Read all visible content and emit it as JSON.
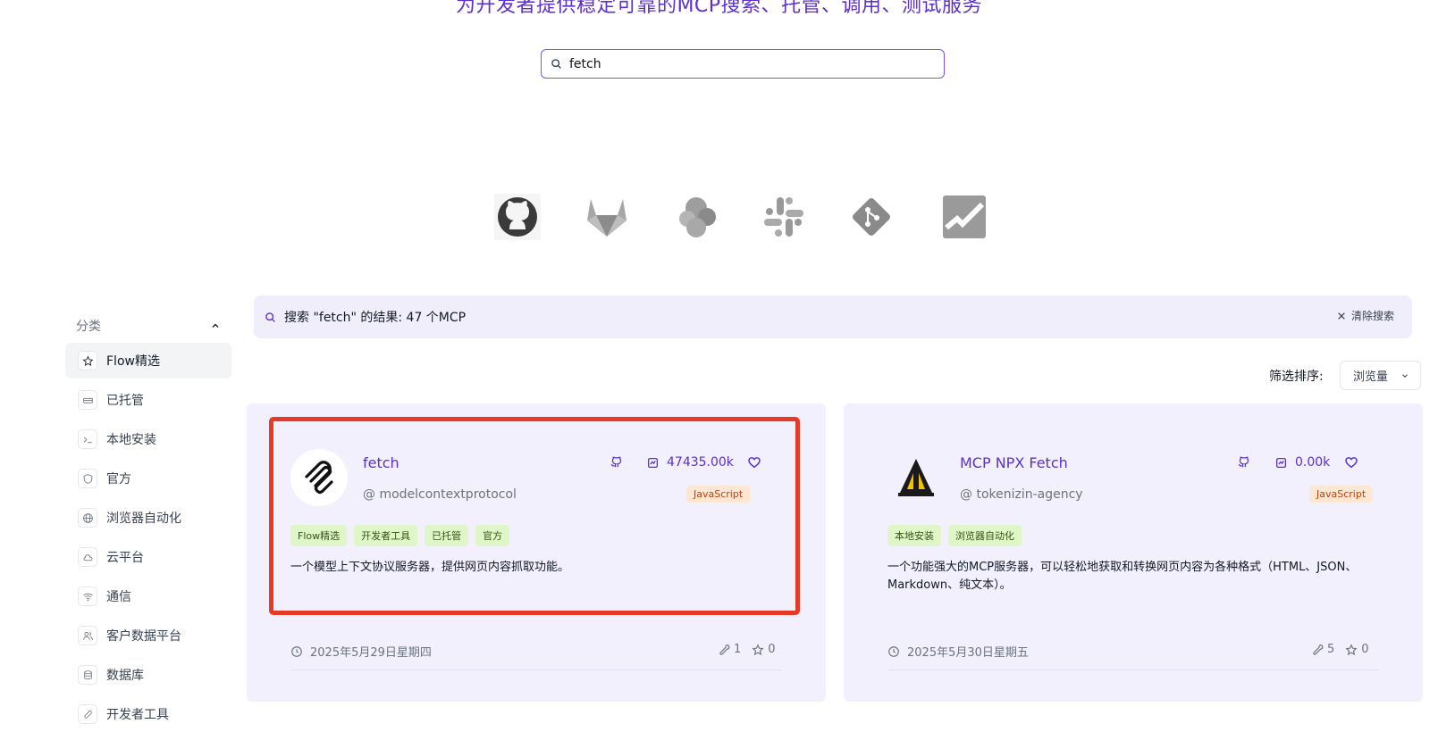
{
  "hero": {
    "title": "为开发者提供稳定可靠的MCP搜索、托管、调用、测试服务"
  },
  "search": {
    "value": "fetch",
    "icon": "search-icon"
  },
  "logos": [
    "github-logo",
    "gitlab-logo",
    "elastic-logo",
    "slack-logo",
    "git-logo",
    "sentry-logo"
  ],
  "sidebar": {
    "header": "分类",
    "items": [
      {
        "label": "Flow精选",
        "icon": "star-icon"
      },
      {
        "label": "已托管",
        "icon": "server-icon"
      },
      {
        "label": "本地安装",
        "icon": "terminal-icon"
      },
      {
        "label": "官方",
        "icon": "shield-icon"
      },
      {
        "label": "浏览器自动化",
        "icon": "globe-icon"
      },
      {
        "label": "云平台",
        "icon": "cloud-icon"
      },
      {
        "label": "通信",
        "icon": "wifi-icon"
      },
      {
        "label": "客户数据平台",
        "icon": "users-icon"
      },
      {
        "label": "数据库",
        "icon": "database-icon"
      },
      {
        "label": "开发者工具",
        "icon": "tool-icon"
      }
    ]
  },
  "results": {
    "text": "搜索 \"fetch\" 的结果: 47 个MCP",
    "clear_label": "清除搜索"
  },
  "sort": {
    "label": "筛选排序:",
    "selected": "浏览量"
  },
  "cards": [
    {
      "title": "fetch",
      "owner": "@ modelcontextprotocol",
      "views": "47435.00k",
      "language": "JavaScript",
      "tags": [
        "Flow精选",
        "开发者工具",
        "已托管",
        "官方"
      ],
      "description": "一个模型上下文协议服务器，提供网页内容抓取功能。",
      "date": "2025年5月29日星期四",
      "tools": "1",
      "stars": "0"
    },
    {
      "title": "MCP NPX Fetch",
      "owner": "@ tokenizin-agency",
      "views": "0.00k",
      "language": "JavaScript",
      "tags": [
        "本地安装",
        "浏览器自动化"
      ],
      "description": "一个功能强大的MCP服务器，可以轻松地获取和转换网页内容为各种格式（HTML、JSON、Markdown、纯文本）。",
      "date": "2025年5月30日星期五",
      "tools": "5",
      "stars": "0"
    }
  ],
  "colors": {
    "accent": "#5b2fd0",
    "highlight": "#e53a26",
    "card_bg": "#f2f0fc"
  }
}
